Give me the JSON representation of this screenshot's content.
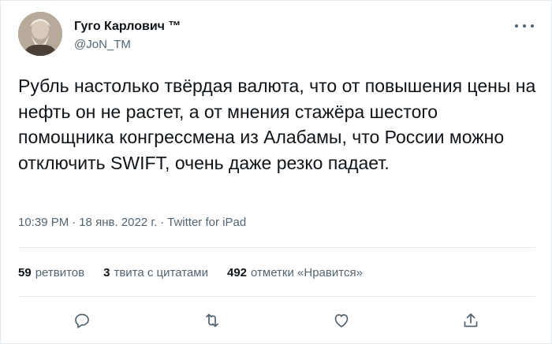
{
  "tweet": {
    "author": {
      "name": "Гуго Карлович ™",
      "handle": "@JoN_TM"
    },
    "text": "Рубль настолько твёрдая валюта, что от повышения цены на нефть он не растет, а от мнения стажёра шестого помощника конгрессмена из Алабамы, что России можно отключить SWIFT, очень даже резко падает.",
    "time": "10:39 PM",
    "date": "18 янв. 2022 г.",
    "separator": "·",
    "source": "Twitter for iPad",
    "stats": {
      "retweets_count": "59",
      "retweets_label": "ретвитов",
      "quotes_count": "3",
      "quotes_label": "твита с цитатами",
      "likes_count": "492",
      "likes_label": "отметки «Нравится»"
    },
    "actions": {
      "reply_icon": "reply-icon",
      "retweet_icon": "retweet-icon",
      "like_icon": "heart-icon",
      "share_icon": "share-icon"
    }
  },
  "colors": {
    "text": "#0f1419",
    "secondary": "#536471",
    "border": "#e6e9eb"
  }
}
